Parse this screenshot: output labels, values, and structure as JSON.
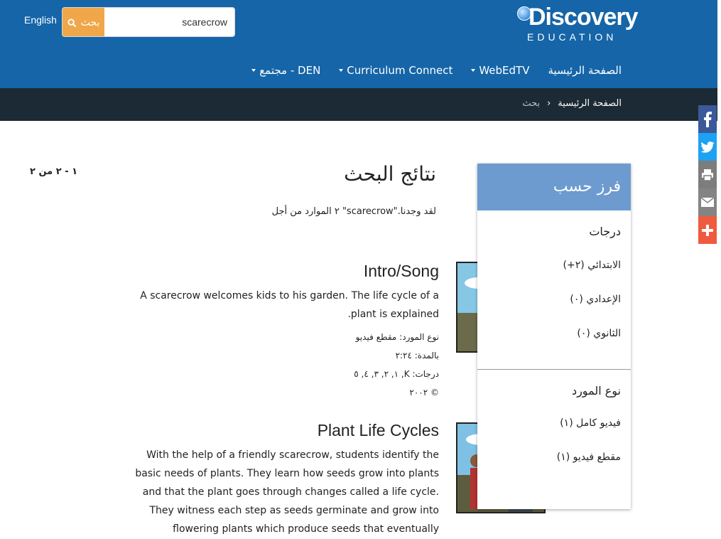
{
  "header": {
    "lang_link": "English",
    "search": {
      "button_label": "بحث",
      "value": "scarecrow"
    },
    "logo": {
      "main": "Discovery",
      "sub": "EDUCATION"
    },
    "nav": [
      {
        "label": "الصفحة الرئيسية",
        "dropdown": false
      },
      {
        "label": "WebEdTV",
        "dropdown": true
      },
      {
        "label": "Curriculum Connect",
        "dropdown": true
      },
      {
        "label": "مجتمع - DEN",
        "dropdown": true
      }
    ]
  },
  "breadcrumb": {
    "home": "الصفحة الرئيسية",
    "separator": "›",
    "current": "بحث"
  },
  "share": [
    "facebook-icon",
    "twitter-icon",
    "print-icon",
    "email-icon",
    "plus-icon"
  ],
  "colors": {
    "header": "#1565a8",
    "crumbbar": "#1b2a35",
    "search_button": "#f0a74a",
    "filter_head": "#6d9bd0"
  },
  "results_header": {
    "range": "١ - ٢ من ٢",
    "title": "نتائج البحث",
    "summary": "٢ الموارد من أجل \"scarecrow\".لقد وجدنا"
  },
  "results": [
    {
      "title": "Intro/Song",
      "description": "A scarecrow welcomes kids to his garden. The life cycle of a plant is explained.",
      "type": "نوع المورد: مقطع فيديو",
      "duration": "بالمدة: ٢:٢٤",
      "grades": "درجات: K, ١, ٢, ٣, ٤, ٥",
      "copyright": "© ٢٠٠٢"
    },
    {
      "title": "Plant Life Cycles",
      "description": "With the help of a friendly scarecrow, students identify the basic needs of plants. They learn how seeds grow into plants and that the plant goes through changes called a life cycle. They witness each step as seeds germinate and grow into flowering plants which produce seeds that eventually germinate and grow again."
    }
  ],
  "filter": {
    "title": "فرز حسب",
    "grades_heading": "درجات",
    "grades": [
      "الابتدائي (٢+)",
      "الإعدادي (٠)",
      "الثانوي (٠)"
    ],
    "type_heading": "نوع المورد",
    "types": [
      "فيديو كامل (١)",
      "مقطع فيديو (١)"
    ]
  }
}
